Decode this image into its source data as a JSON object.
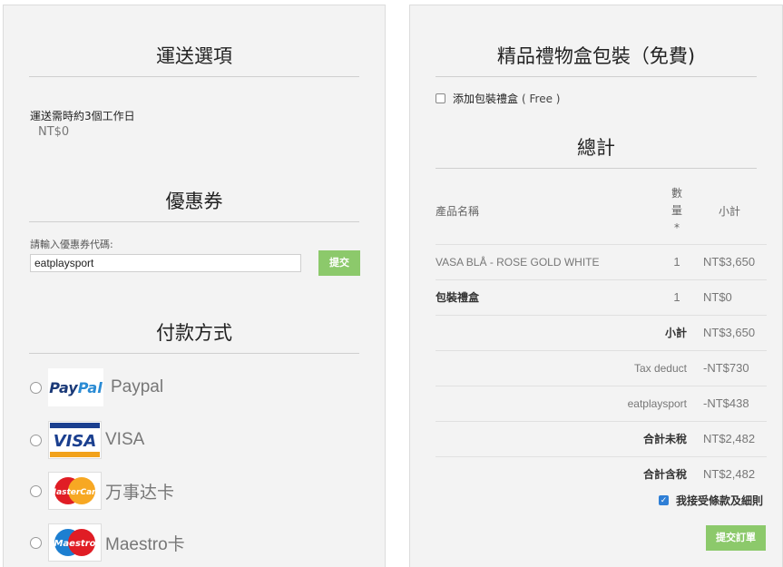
{
  "shipping": {
    "title": "運送選項",
    "description": "運送需時約3個工作日",
    "price": "NT$0"
  },
  "coupon": {
    "title": "優惠券",
    "label": "請輸入優惠券代碼:",
    "value": "eatplaysport",
    "submit_label": "提交"
  },
  "payment": {
    "title": "付款方式",
    "methods": [
      {
        "label": "Paypal",
        "icon": "paypal-logo"
      },
      {
        "label": "VISA",
        "icon": "visa-logo"
      },
      {
        "label": "万事达卡",
        "icon": "mastercard-logo"
      },
      {
        "label": "Maestro卡",
        "icon": "maestro-logo"
      }
    ],
    "logos": {
      "paypal": "PayPal",
      "visa": "VISA",
      "mastercard": "MasterCard",
      "maestro": "Maestro"
    }
  },
  "giftbox": {
    "title": "精品禮物盒包裝（免費)",
    "option_label": "添加包裝禮盒",
    "option_note": "( Free )"
  },
  "summary": {
    "title": "總計",
    "headers": {
      "name": "產品名稱",
      "qty": "數量*",
      "subtotal": "小計"
    },
    "items": [
      {
        "name": "VASA BLÅ - ROSE GOLD WHITE",
        "qty": "1",
        "subtotal": "NT$3,650"
      },
      {
        "name": "包裝禮盒",
        "qty": "1",
        "subtotal": "NT$0"
      }
    ],
    "totals": [
      {
        "label": "小計",
        "value": "NT$3,650"
      },
      {
        "label": "Tax deduct",
        "value": "-NT$730"
      },
      {
        "label": "eatplaysport",
        "value": "-NT$438"
      },
      {
        "label": "合計未稅",
        "value": "NT$2,482"
      },
      {
        "label": "合計含稅",
        "value": "NT$2,482"
      }
    ]
  },
  "terms": {
    "label": "我接受條款及細則"
  },
  "place_order_label": "提交訂單",
  "colors": {
    "accent_green": "#8cc96b",
    "checkbox_blue": "#2f7fd6",
    "panel_bg": "#f3f3f3"
  }
}
